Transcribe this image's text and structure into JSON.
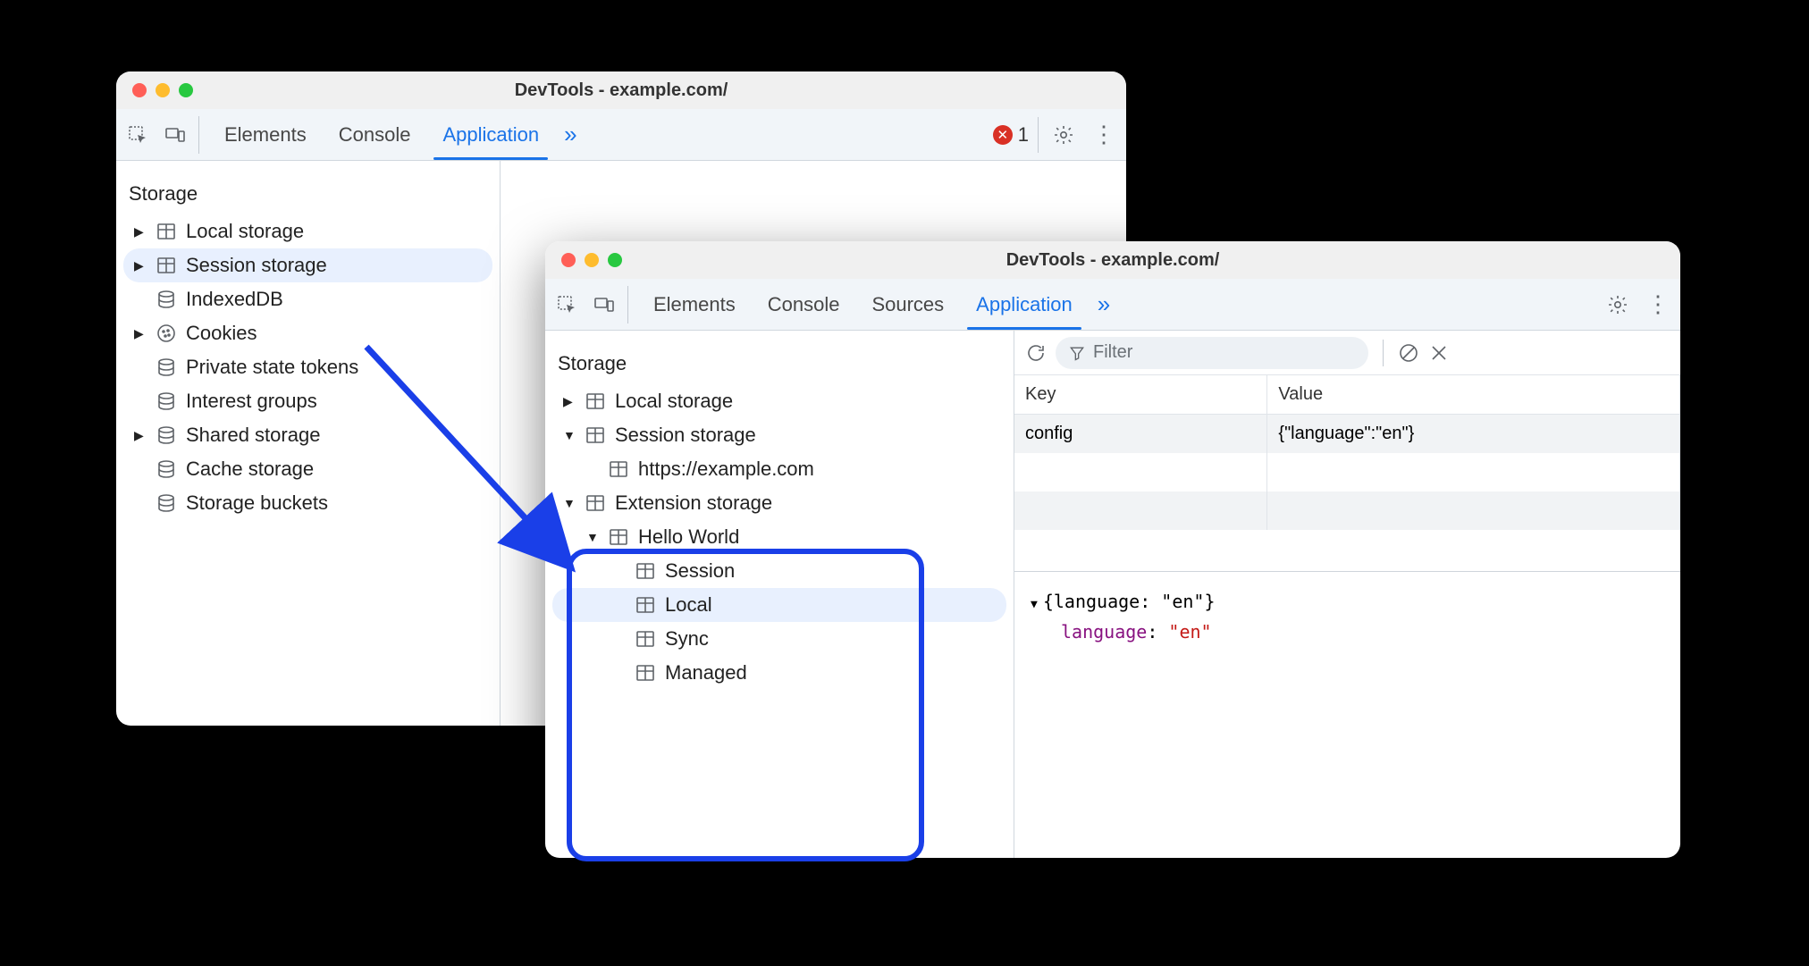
{
  "window1": {
    "title": "DevTools - example.com/",
    "tabs": {
      "elements": "Elements",
      "console": "Console",
      "application": "Application"
    },
    "error_count": "1",
    "storage_header": "Storage",
    "tree": {
      "local_storage": "Local storage",
      "session_storage": "Session storage",
      "indexeddb": "IndexedDB",
      "cookies": "Cookies",
      "private_tokens": "Private state tokens",
      "interest_groups": "Interest groups",
      "shared_storage": "Shared storage",
      "cache_storage": "Cache storage",
      "storage_buckets": "Storage buckets"
    }
  },
  "window2": {
    "title": "DevTools - example.com/",
    "tabs": {
      "elements": "Elements",
      "console": "Console",
      "sources": "Sources",
      "application": "Application"
    },
    "storage_header": "Storage",
    "tree": {
      "local_storage": "Local storage",
      "session_storage": "Session storage",
      "session_child": "https://example.com",
      "extension_storage": "Extension storage",
      "hello_world": "Hello World",
      "session": "Session",
      "local": "Local",
      "sync": "Sync",
      "managed": "Managed"
    },
    "detail": {
      "filter_placeholder": "Filter",
      "col_key": "Key",
      "col_value": "Value",
      "row0_key": "config",
      "row0_value": "{\"language\":\"en\"}",
      "preview_head": "{language: \"en\"}",
      "preview_key": "language",
      "preview_colon": ": ",
      "preview_val": "\"en\""
    }
  }
}
